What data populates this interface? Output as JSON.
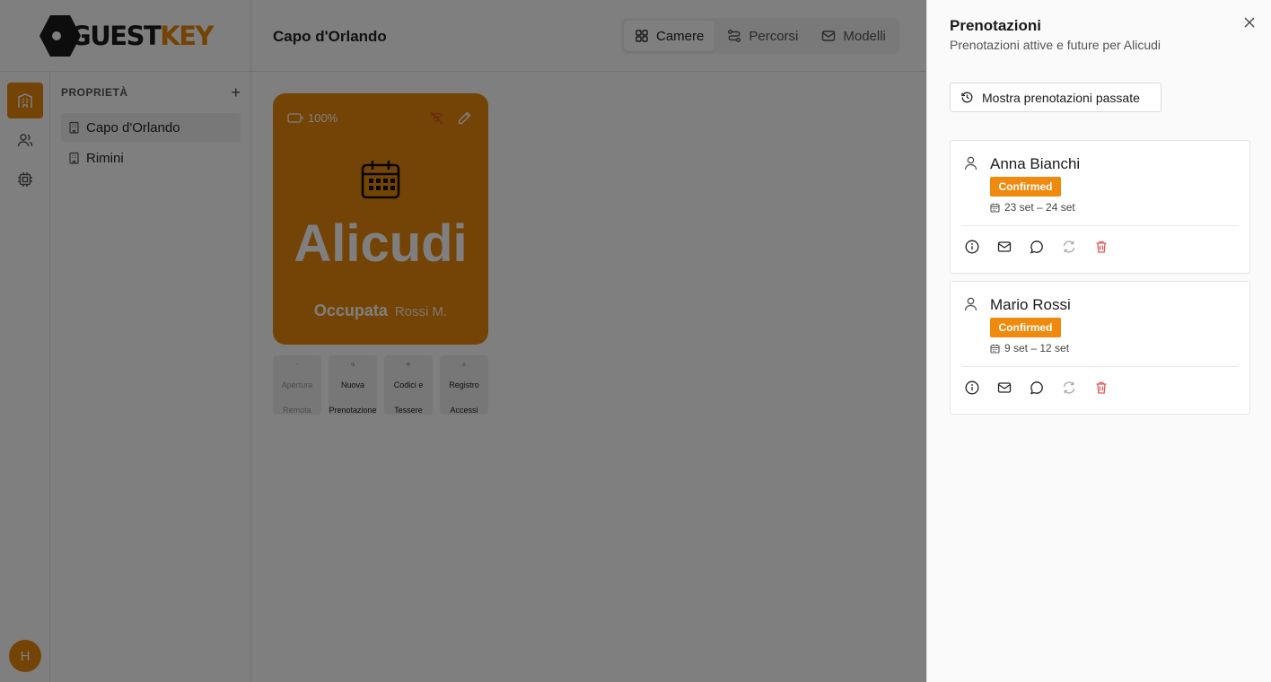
{
  "header": {
    "logo": {
      "prefix": "GUEST",
      "suffix": "KEY"
    },
    "title": "Capo d'Orlando",
    "tabs": [
      {
        "label": "Camere",
        "icon": "grid-icon",
        "active": true
      },
      {
        "label": "Percorsi",
        "icon": "route-icon",
        "active": false
      },
      {
        "label": "Modelli",
        "icon": "mail-icon",
        "active": false
      }
    ]
  },
  "rail": {
    "items": [
      {
        "icon": "building-icon",
        "active": true
      },
      {
        "icon": "users-icon",
        "active": false
      },
      {
        "icon": "chip-icon",
        "active": false
      }
    ],
    "avatar_initial": "H"
  },
  "properties": {
    "label": "PROPRIETÀ",
    "add_label": "+",
    "items": [
      {
        "label": "Capo d'Orlando",
        "active": true
      },
      {
        "label": "Rimini",
        "active": false
      }
    ]
  },
  "room": {
    "name": "Alicudi",
    "battery": "100%",
    "status": "Occupata",
    "guest": "Rossi M.",
    "accent_color": "#e8890c",
    "actions": [
      {
        "label_line1": "Apertura",
        "label_line2": "Remota",
        "icon": "key-icon",
        "disabled": true
      },
      {
        "label_line1": "Nuova",
        "label_line2": "Prenotazione",
        "icon": "calendar-plus-icon",
        "disabled": false
      },
      {
        "label_line1": "Codici e",
        "label_line2": "Tessere",
        "icon": "card-icon",
        "disabled": false
      },
      {
        "label_line1": "Registro",
        "label_line2": "Accessi",
        "icon": "clock-icon",
        "disabled": false
      }
    ]
  },
  "sheet": {
    "title": "Prenotazioni",
    "subtitle": "Prenotazioni attive e future per Alicudi",
    "past_button": "Mostra prenotazioni passate",
    "bookings": [
      {
        "name": "Anna Bianchi",
        "status": "Confirmed",
        "dates": "23 set – 24 set"
      },
      {
        "name": "Mario Rossi",
        "status": "Confirmed",
        "dates": "9 set – 12 set"
      }
    ],
    "status_color": "#f08a0f"
  }
}
